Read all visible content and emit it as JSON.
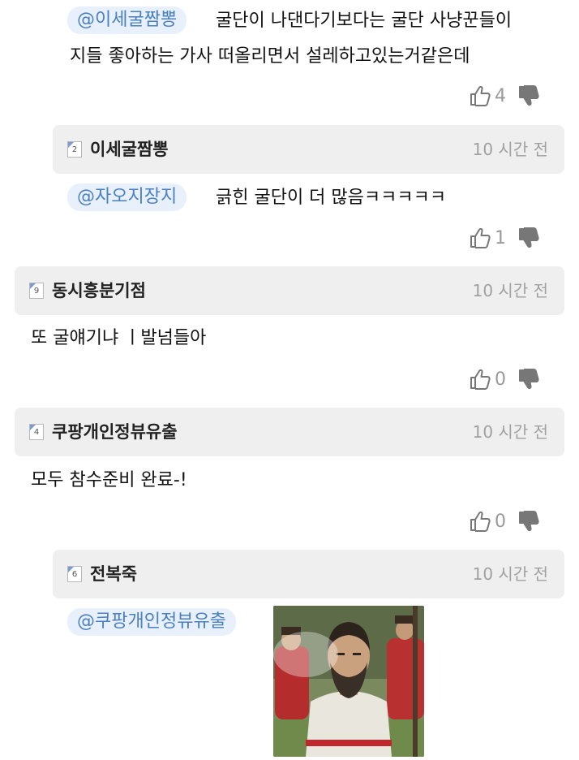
{
  "comments": [
    {
      "mention": "@이세굴짬뽕",
      "text_line1": "굴단이 나댄다기보다는 굴단 사냥꾼들이",
      "text_line2": "지들 좋아하는 가사 떠올리면서 설레하고있는거같은데",
      "likes": "4"
    },
    {
      "level": "2",
      "username": "이세굴짬뽕",
      "time": "10 시간 전",
      "mention": "@자오지장지",
      "text": "긁힌 굴단이 더 많음ㅋㅋㅋㅋㅋ",
      "likes": "1"
    },
    {
      "level": "9",
      "username": "동시흥분기점",
      "time": "10 시간 전",
      "text": "또 굴얘기냐 ㅣ발넘들아",
      "likes": "0"
    },
    {
      "level": "4",
      "username": "쿠팡개인정뷰유출",
      "time": "10 시간 전",
      "text": "모두 참수준비 완료-!",
      "likes": "0"
    },
    {
      "level": "6",
      "username": "전복죽",
      "time": "10 시간 전",
      "mention": "@쿠팡개인정뷰유출"
    }
  ],
  "icons": {
    "like": "thumbs-up-icon",
    "dislike": "thumbs-down-icon",
    "photo": "attached-photo"
  },
  "colors": {
    "mention_bg": "#e8f1fb",
    "mention_text": "#4a7fc1",
    "header_bg": "#efefef",
    "muted": "#a0a0a0"
  }
}
